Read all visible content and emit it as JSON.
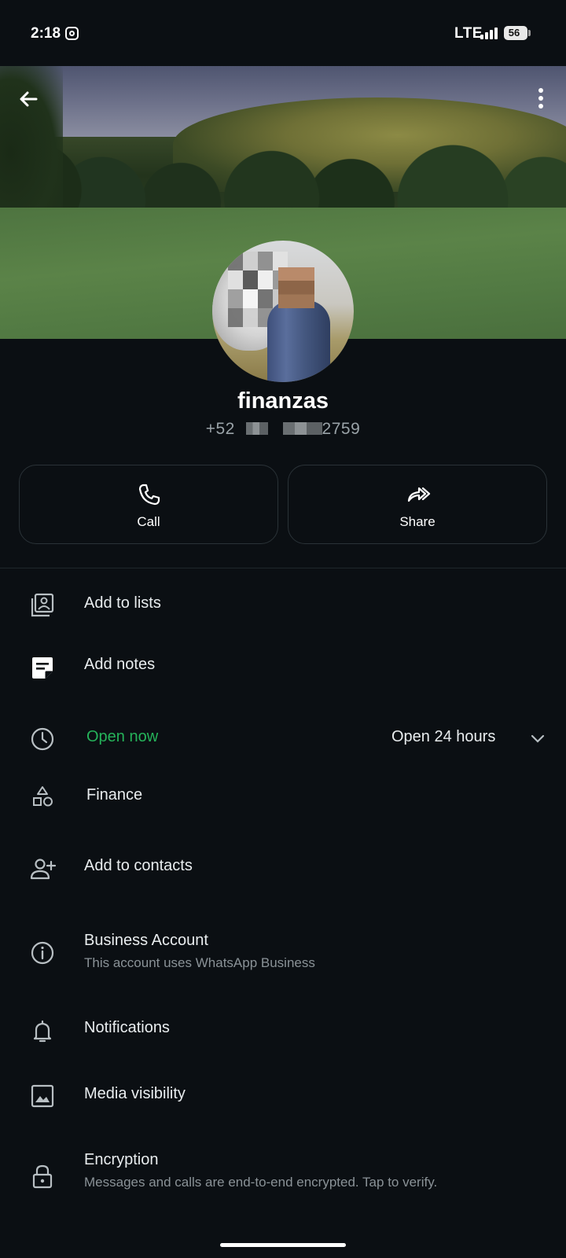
{
  "status_bar": {
    "time": "2:18",
    "network": "LTE",
    "battery": "56"
  },
  "header": {
    "back_icon": "arrow-left-icon",
    "menu_icon": "more-vertical-icon"
  },
  "profile": {
    "name": "finanzas",
    "phone_prefix": "+52",
    "phone_suffix": "2759"
  },
  "actions": [
    {
      "label": "Call",
      "icon": "phone-icon"
    },
    {
      "label": "Share",
      "icon": "share-icon"
    }
  ],
  "list": {
    "add_to_lists": "Add to lists",
    "add_notes": "Add notes",
    "hours_status": "Open now",
    "hours_value": "Open 24 hours",
    "category": "Finance",
    "add_to_contacts": "Add to contacts",
    "business_title": "Business Account",
    "business_sub": "This account uses WhatsApp Business",
    "notifications": "Notifications",
    "media_visibility": "Media visibility",
    "encryption_title": "Encryption",
    "encryption_sub": "Messages and calls are end-to-end encrypted. Tap to verify."
  },
  "colors": {
    "background": "#0b0f13",
    "accent_green": "#25b35a",
    "secondary_text": "#8a9297"
  }
}
